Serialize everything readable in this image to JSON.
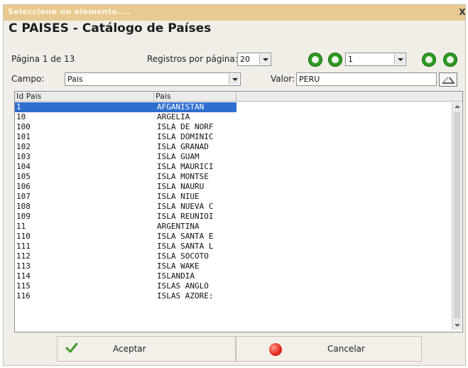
{
  "window": {
    "title": "Seleccione un elemento....",
    "close_glyph": "X"
  },
  "heading": "C  PAISES - Catálogo de Países",
  "pagination": {
    "page_label": "Página 1 de 13",
    "per_page_label": "Registros por página:",
    "per_page_value": "20",
    "page_select_value": "1"
  },
  "filter": {
    "field_label": "Campo:",
    "field_value": "Pais",
    "value_label": "Valor:",
    "value_text": "PERU"
  },
  "table": {
    "columns": [
      "Id Pais",
      "Pais"
    ],
    "rows": [
      [
        "1",
        "AFGANISTAN"
      ],
      [
        "10",
        "ARGELIA"
      ],
      [
        "100",
        "ISLA DE NORF"
      ],
      [
        "101",
        "ISLA DOMINIC"
      ],
      [
        "102",
        "ISLA GRANAD"
      ],
      [
        "103",
        "ISLA GUAM"
      ],
      [
        "104",
        "ISLA MAURICI"
      ],
      [
        "105",
        "ISLA MONTSE"
      ],
      [
        "106",
        "ISLA NAURU"
      ],
      [
        "107",
        "ISLA NIUE"
      ],
      [
        "108",
        "ISLA NUEVA C"
      ],
      [
        "109",
        "ISLA REUNIOI"
      ],
      [
        "11",
        "ARGENTINA"
      ],
      [
        "110",
        "ISLA SANTA E"
      ],
      [
        "111",
        "ISLA SANTA L"
      ],
      [
        "112",
        "ISLA SOCOTO"
      ],
      [
        "113",
        "ISLA WAKE"
      ],
      [
        "114",
        "ISLANDIA"
      ],
      [
        "115",
        "ISLAS ANGLO"
      ],
      [
        "116",
        "ISLAS AZORE:"
      ]
    ],
    "selected_row": 0
  },
  "buttons": {
    "accept": "Aceptar",
    "cancel": "Cancelar"
  },
  "colors": {
    "title_bar": "#e8c98f",
    "selection": "#2e6fcf",
    "nav_green": "#2f9a22",
    "cancel_red": "#e3271a"
  },
  "icons": [
    "close-icon",
    "nav-first-icon",
    "nav-prev-icon",
    "nav-next-icon",
    "nav-last-icon",
    "clear-filter-icon",
    "checkmark-icon",
    "red-circle-icon"
  ]
}
